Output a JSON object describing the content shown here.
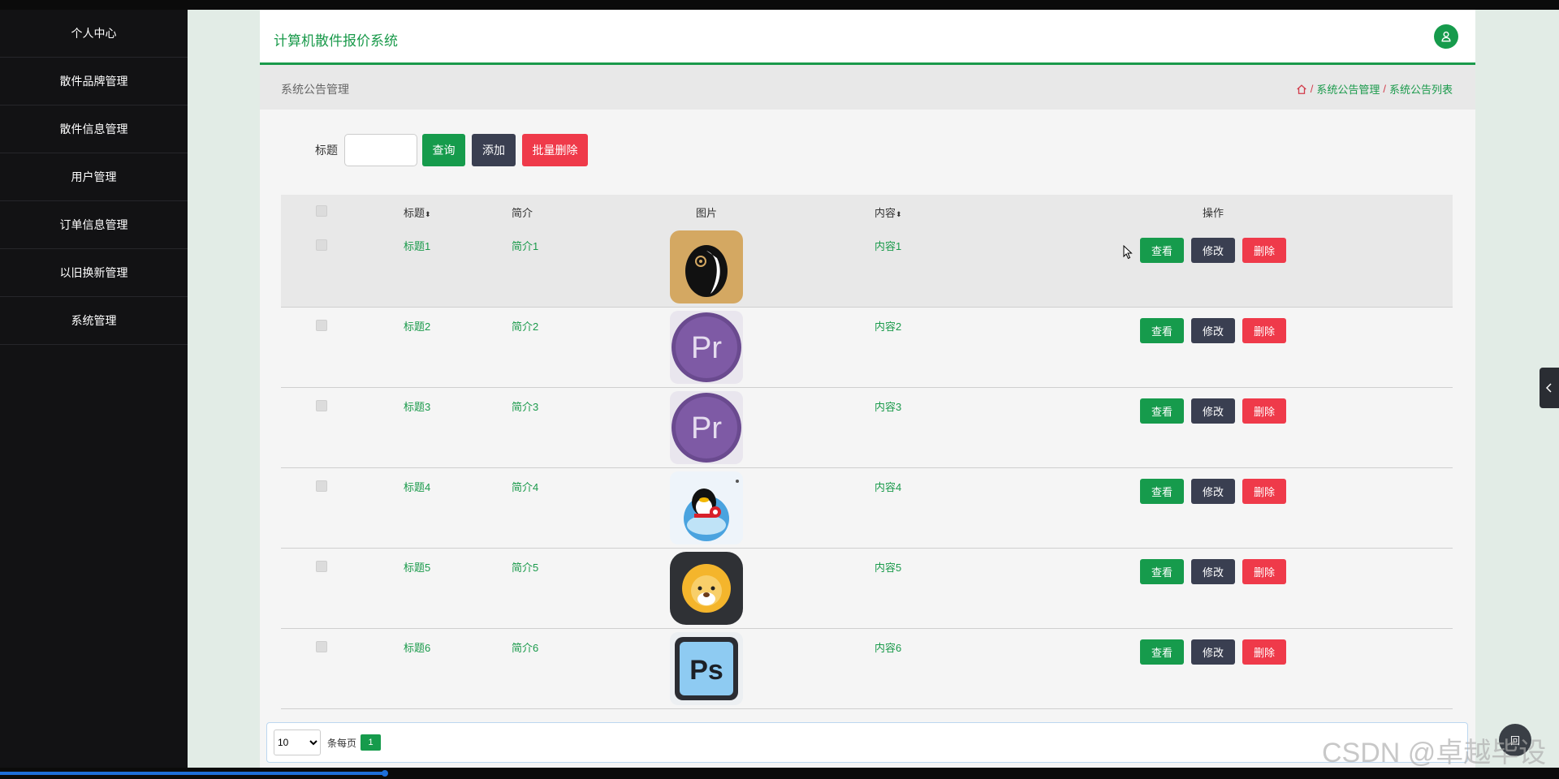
{
  "app": {
    "title": "计算机散件报价系统"
  },
  "sidebar": {
    "items": [
      {
        "label": "个人中心"
      },
      {
        "label": "散件品牌管理"
      },
      {
        "label": "散件信息管理"
      },
      {
        "label": "用户管理"
      },
      {
        "label": "订单信息管理"
      },
      {
        "label": "以旧换新管理"
      },
      {
        "label": "系统管理"
      }
    ]
  },
  "page": {
    "name": "系统公告管理"
  },
  "breadcrumb": {
    "sep": "/",
    "items": [
      "系统公告管理",
      "系统公告列表"
    ]
  },
  "search": {
    "label": "标题",
    "value": "",
    "placeholder": ""
  },
  "toolbar": {
    "query": "查询",
    "add": "添加",
    "batch_delete": "批量删除"
  },
  "table": {
    "headers": {
      "title": "标题",
      "intro": "简介",
      "image": "图片",
      "content": "内容",
      "ops": "操作",
      "sort": "⬍"
    },
    "rows": [
      {
        "title": "标题1",
        "intro": "简介1",
        "content": "内容1",
        "image": "penguin-app-icon"
      },
      {
        "title": "标题2",
        "intro": "简介2",
        "content": "内容2",
        "image": "premiere-icon"
      },
      {
        "title": "标题3",
        "intro": "简介3",
        "content": "内容3",
        "image": "premiere-icon"
      },
      {
        "title": "标题4",
        "intro": "简介4",
        "content": "内容4",
        "image": "qq-icon"
      },
      {
        "title": "标题5",
        "intro": "简介5",
        "content": "内容5",
        "image": "lion-icon"
      },
      {
        "title": "标题6",
        "intro": "简介6",
        "content": "内容6",
        "image": "photoshop-icon"
      }
    ],
    "actions": {
      "view": "查看",
      "edit": "修改",
      "delete": "删除"
    }
  },
  "pager": {
    "page_size": "10",
    "per_page_label": "条每页",
    "current_page": "1"
  },
  "float_button": "回",
  "watermark": "CSDN @卓越毕设",
  "colors": {
    "accent": "#169b4c",
    "danger": "#ef3a4a",
    "dark": "#3a3f51",
    "sidebar": "#121214"
  }
}
